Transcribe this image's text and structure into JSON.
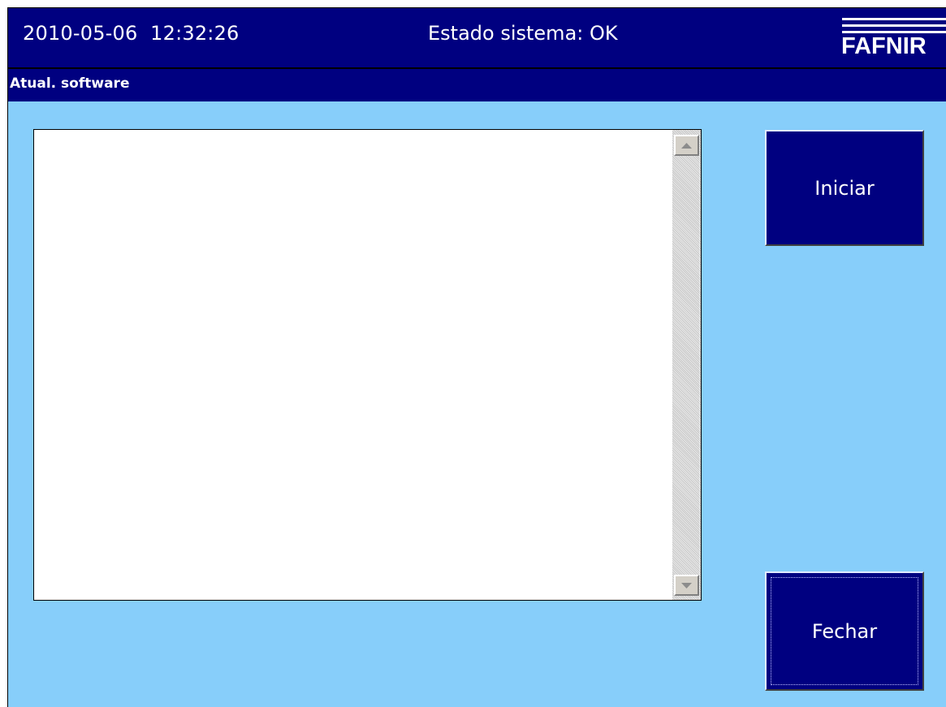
{
  "header": {
    "datetime": "2010-05-06  12:32:26",
    "status": "Estado sistema: OK",
    "logo_text": "FAFNIR"
  },
  "subbar": {
    "title": "Atual. software"
  },
  "log": {
    "content": ""
  },
  "buttons": {
    "start_label": "Iniciar",
    "close_label": "Fechar"
  },
  "icons": {
    "scroll_up": "scroll-up-arrow-icon",
    "scroll_down": "scroll-down-arrow-icon"
  },
  "colors": {
    "header_bg": "#000080",
    "screen_bg": "#87cefa",
    "button_bg": "#000080",
    "text_light": "#ffffff"
  }
}
